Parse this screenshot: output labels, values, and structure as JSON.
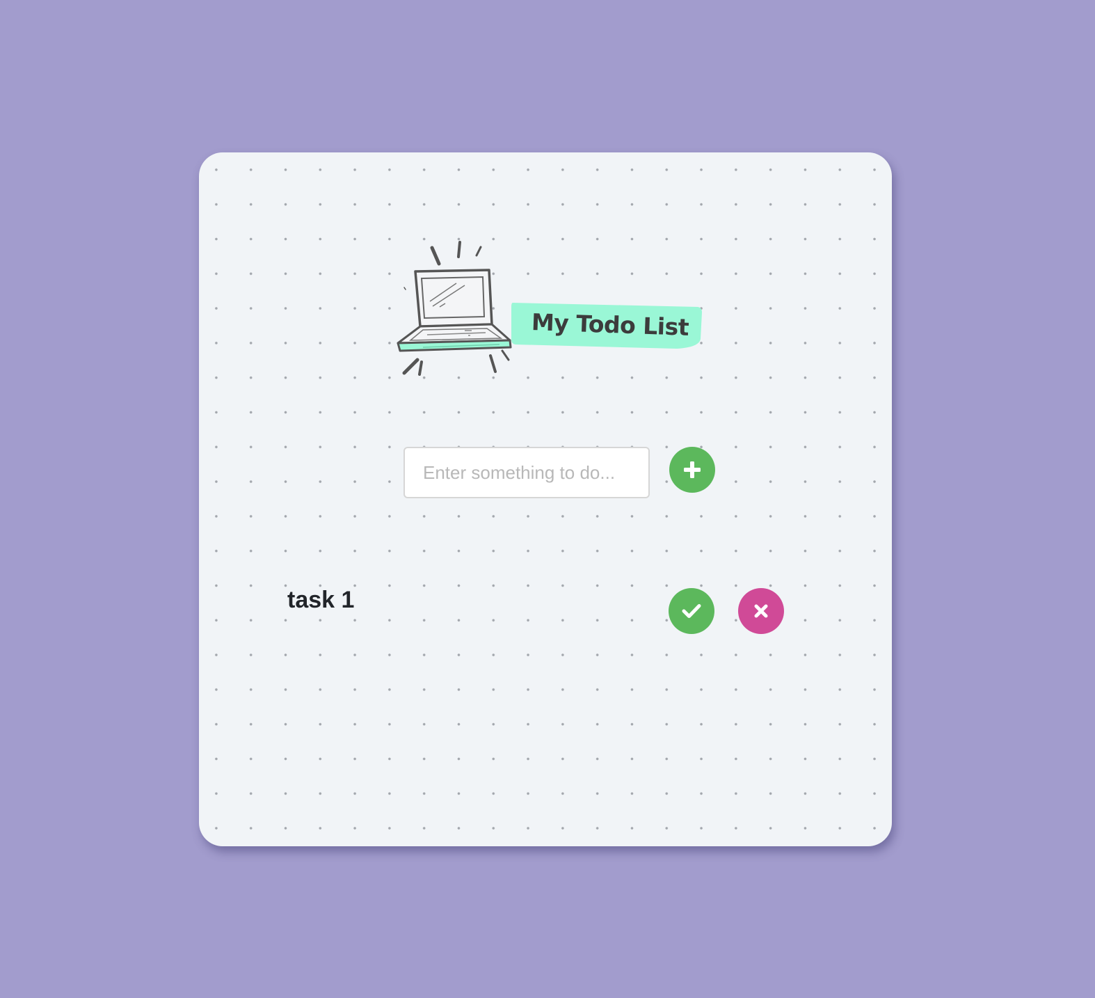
{
  "app": {
    "title": "My Todo List",
    "logo_icon": "laptop-icon"
  },
  "input": {
    "value": "",
    "placeholder": "Enter something to do..."
  },
  "actions": {
    "add_icon": "plus-icon"
  },
  "tasks": [
    {
      "label": "task 1",
      "complete_icon": "check-icon",
      "delete_icon": "close-icon"
    }
  ],
  "colors": {
    "page_background": "#a29ccd",
    "card_background": "#f1f4f7",
    "title_highlight": "#9af7d6",
    "success": "#5cb85c",
    "danger": "#d04a97"
  }
}
